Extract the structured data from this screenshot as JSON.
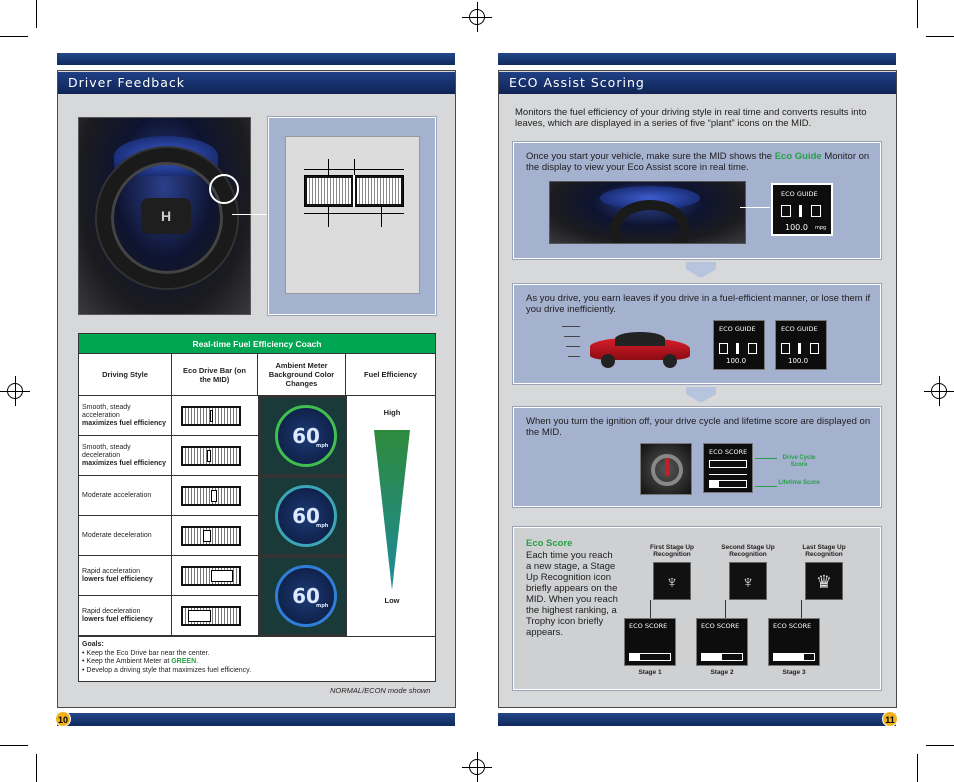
{
  "left_page": {
    "title": "Driver Feedback",
    "coach_table": {
      "title": "Real-time Fuel Efficiency Coach",
      "headers": [
        "Driving Style",
        "Eco Drive Bar (on the MID)",
        "Ambient Meter Background Color Changes",
        "Fuel Efficiency"
      ],
      "rows": [
        {
          "style": "Smooth, steady acceleration",
          "effect": "maximizes fuel efficiency",
          "bar": 0.48
        },
        {
          "style": "Smooth, steady deceleration",
          "effect": "maximizes fuel efficiency",
          "bar": 0.44
        },
        {
          "style": "Moderate acceleration",
          "effect": "",
          "bar": 0.6
        },
        {
          "style": "Moderate deceleration",
          "effect": "",
          "bar": 0.36
        },
        {
          "style": "Rapid acceleration",
          "effect": "lowers fuel efficiency",
          "bar": 0.86
        },
        {
          "style": "Rapid deceleration",
          "effect": "lowers fuel efficiency",
          "bar": 0.12
        }
      ],
      "gauge_value": "60",
      "gauge_unit": "mph",
      "efficiency_high": "High",
      "efficiency_low": "Low",
      "goals_title": "Goals:",
      "goal_1": "• Keep the Eco Drive bar near the center.",
      "goal_2_prefix": "• Keep the Ambient Meter at",
      "goal_2_highlight": "GREEN",
      "goal_2_suffix": ".",
      "goal_3": "• Develop a driving style that maximizes fuel efficiency.",
      "ambient_colors": [
        "#3fbf4f",
        "#3aa6b8",
        "#2f7fd8"
      ]
    },
    "footnote": "NORMAL/ECON mode shown",
    "page_number": "10"
  },
  "right_page": {
    "title": "ECO Assist Scoring",
    "intro": "Monitors the fuel efficiency of your driving style in real time and converts results into leaves, which are displayed in a series of five “plant” icons on the MID.",
    "panel1_text_a": "Once you start your vehicle, make sure the MID shows the",
    "panel1_highlight": "Eco Guide",
    "panel1_text_b": "Monitor on the display to view your Eco Assist score in real time.",
    "eco_guide_label": "ECO GUIDE",
    "eco_guide_value": "100.0",
    "eco_guide_unit": "mpg",
    "panel2_text": "As you drive, you earn leaves if you drive in a fuel-efficient manner, or lose them if you drive inefficiently.",
    "panel3_text": "When you turn the ignition off, your drive cycle and lifetime score are displayed on the MID.",
    "eco_score_label": "ECO SCORE",
    "drive_cycle_label": "Drive Cycle Score",
    "lifetime_label": "Lifetime Score",
    "eco_score_title": "Eco Score",
    "eco_score_text": "Each time you reach a new stage, a Stage Up Recognition icon briefly appears on the MID. When you reach the highest ranking, a Trophy icon briefly appears.",
    "stages": [
      {
        "recognition": "First Stage Up Recognition",
        "label": "Stage 1"
      },
      {
        "recognition": "Second Stage Up Recognition",
        "label": "Stage 2"
      },
      {
        "recognition": "Last Stage Up Recognition",
        "label": "Stage 3"
      }
    ],
    "page_number": "11"
  }
}
